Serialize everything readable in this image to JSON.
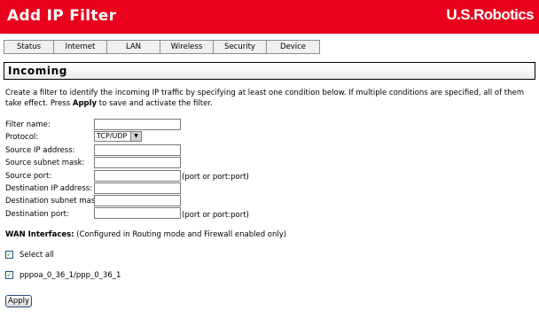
{
  "header": {
    "title": "Add IP Filter",
    "logo_text": "U.S.Robotics",
    "color": "#e8001c"
  },
  "tabs": [
    {
      "label": "Status"
    },
    {
      "label": "Internet"
    },
    {
      "label": "LAN"
    },
    {
      "label": "Wireless"
    },
    {
      "label": "Security"
    },
    {
      "label": "Device"
    }
  ],
  "section": {
    "title": "Incoming"
  },
  "description": {
    "text_before": "Create a filter to identify the incoming IP traffic by specifying at least one condition below. If multiple conditions are specified, all of them take effect. Press ",
    "bold_word": "Apply",
    "text_after": " to save and activate the filter."
  },
  "form": {
    "filter_name": {
      "label": "Filter name:",
      "value": ""
    },
    "protocol": {
      "label": "Protocol:",
      "selected": "TCP/UDP"
    },
    "source_ip": {
      "label": "Source IP address:",
      "value": ""
    },
    "source_mask": {
      "label": "Source subnet mask:",
      "value": ""
    },
    "source_port": {
      "label": "Source port:",
      "value": "",
      "hint": "(port or port:port)"
    },
    "dest_ip": {
      "label": "Destination IP address:",
      "value": ""
    },
    "dest_mask": {
      "label": "Destination subnet mask:",
      "value": ""
    },
    "dest_port": {
      "label": "Destination port:",
      "value": "",
      "hint": "(port or port:port)"
    }
  },
  "wan": {
    "heading": "WAN Interfaces:",
    "note": " (Configured in Routing mode and Firewall enabled only)",
    "select_all": {
      "label": "Select all",
      "checked": true
    },
    "interfaces": [
      {
        "label": "pppoa_0_36_1/ppp_0_36_1",
        "checked": true
      }
    ]
  },
  "buttons": {
    "apply_label": "Apply"
  }
}
